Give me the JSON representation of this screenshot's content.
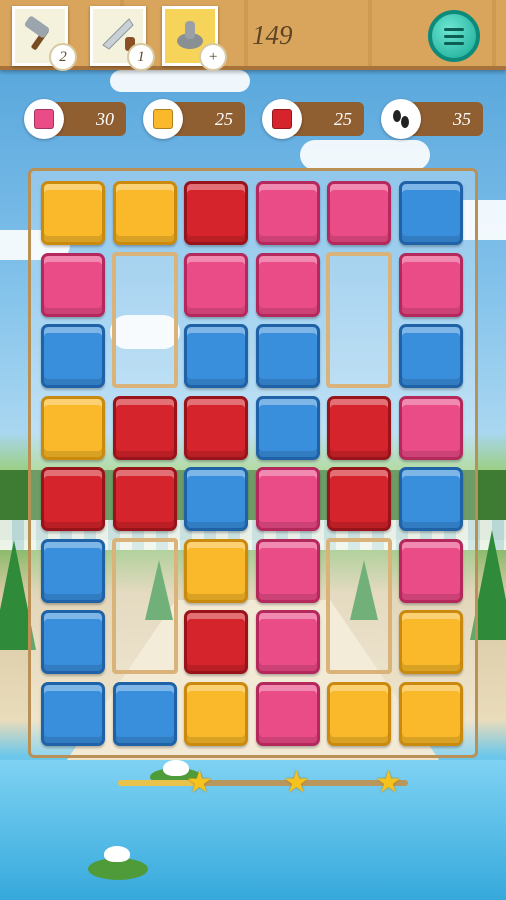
{
  "topbar": {
    "boosters": [
      {
        "name": "hammer",
        "icon": "hammer-icon",
        "count": "2"
      },
      {
        "name": "saw",
        "icon": "saw-icon",
        "count": "1"
      },
      {
        "name": "cannon",
        "icon": "cannon-icon",
        "count": "+"
      }
    ],
    "score": "149",
    "menu_icon": "menu-icon"
  },
  "goals": [
    {
      "tile": "pink",
      "value": "30",
      "icon": "pink-block-icon"
    },
    {
      "tile": "yellow",
      "value": "25",
      "icon": "yellow-block-icon"
    },
    {
      "tile": "red",
      "value": "25",
      "icon": "red-block-icon"
    },
    {
      "tile": "moves",
      "value": "35",
      "icon": "footprints-icon"
    }
  ],
  "colors": {
    "yellow": "#f9b92a",
    "red": "#d5242c",
    "pink": "#ea4c87",
    "blue": "#3a8fdc"
  },
  "board": {
    "rows": [
      [
        "yellow",
        "yellow",
        "red",
        "pink",
        "pink",
        "blue"
      ],
      [
        "pink",
        "",
        "pink",
        "pink",
        "",
        "pink"
      ],
      [
        "blue",
        "",
        "blue",
        "blue",
        "",
        "blue"
      ],
      [
        "yellow",
        "red",
        "red",
        "blue",
        "red",
        "pink"
      ],
      [
        "red",
        "red",
        "blue",
        "pink",
        "red",
        "blue"
      ],
      [
        "blue",
        "",
        "yellow",
        "pink",
        "",
        "pink"
      ],
      [
        "blue",
        "",
        "red",
        "pink",
        "",
        "yellow"
      ],
      [
        "blue",
        "blue",
        "yellow",
        "pink",
        "yellow",
        "yellow"
      ]
    ]
  },
  "progress": {
    "fraction": 0.28,
    "stars": 3
  }
}
